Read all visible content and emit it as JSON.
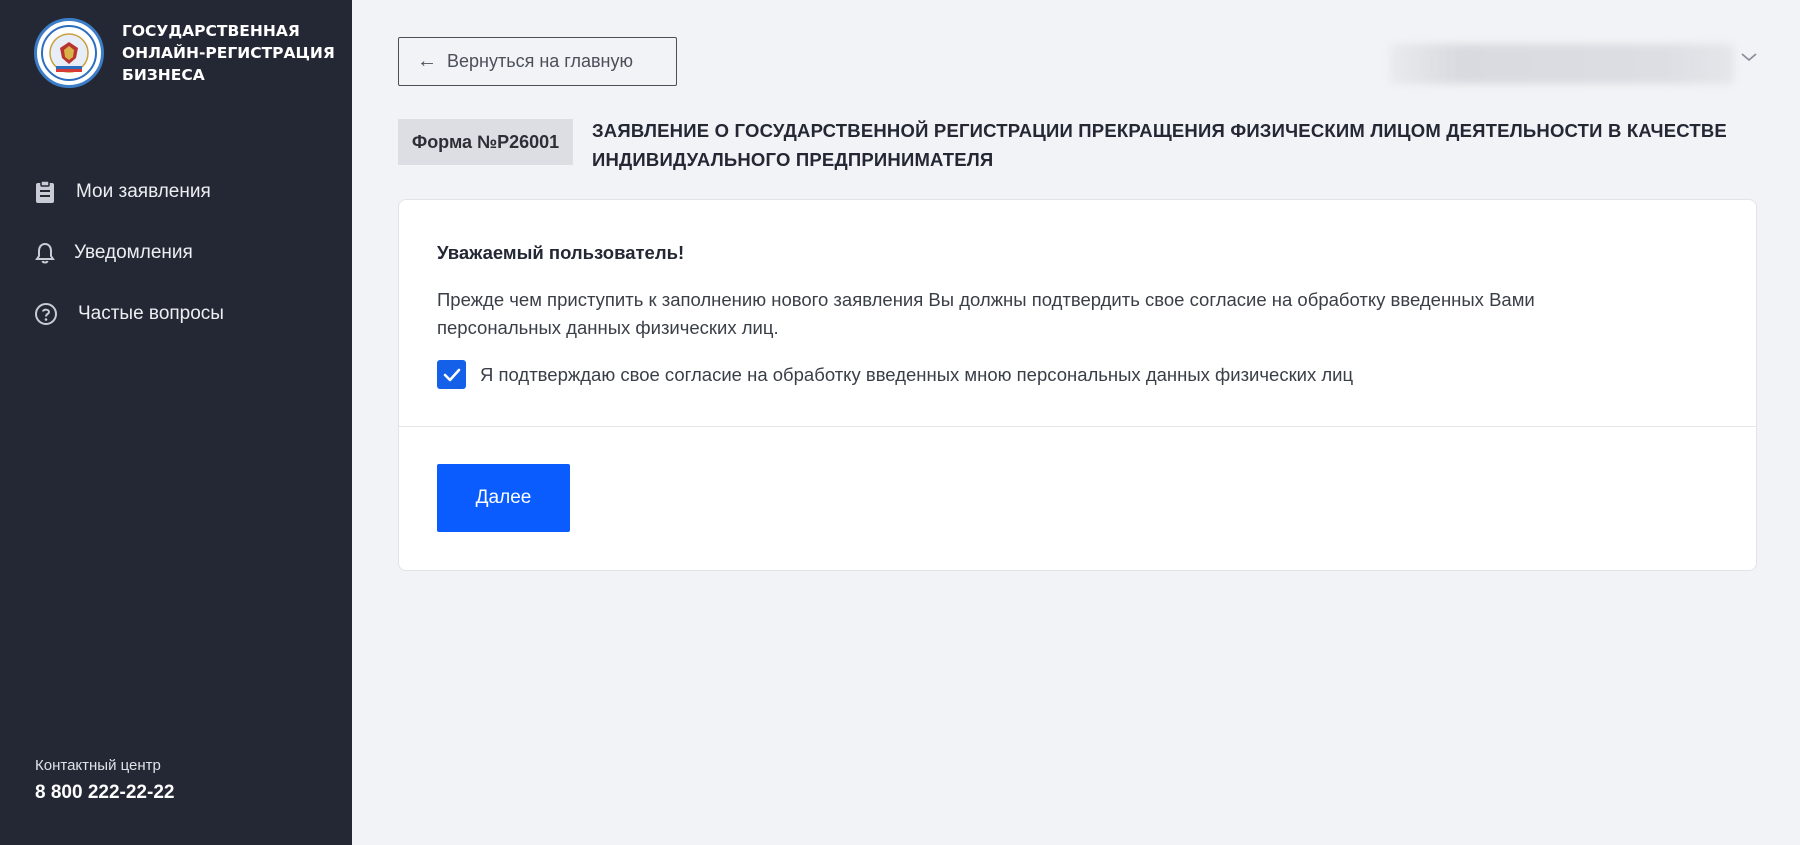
{
  "sidebar": {
    "brand_lines": [
      "ГОСУДАРСТВЕННАЯ",
      "ОНЛАЙН-РЕГИСТРАЦИЯ",
      "БИЗНЕСА"
    ],
    "items": [
      {
        "label": "Мои заявления",
        "icon": "clipboard-icon"
      },
      {
        "label": "Уведомления",
        "icon": "bell-icon"
      },
      {
        "label": "Частые вопросы",
        "icon": "question-circle-icon"
      }
    ],
    "contact_label": "Контактный центр",
    "contact_phone": "8 800 222-22-22"
  },
  "header": {
    "back_label": "Вернуться на главную"
  },
  "form": {
    "badge": "Форма №Р26001",
    "title": "ЗАЯВЛЕНИЕ О ГОСУДАРСТВЕННОЙ РЕГИСТРАЦИИ ПРЕКРАЩЕНИЯ ФИЗИЧЕСКИМ ЛИЦОМ ДЕЯТЕЛЬНОСТИ В КАЧЕСТВЕ ИНДИВИДУАЛЬНОГО ПРЕДПРИНИМАТЕЛЯ"
  },
  "card": {
    "greeting": "Уважаемый пользователь!",
    "intro": "Прежде чем приступить к заполнению нового заявления Вы должны подтвердить свое согласие на обработку введенных Вами персональных данных физических лиц.",
    "consent_label": "Я подтверждаю свое согласие на обработку введенных мною персональных данных физических лиц",
    "consent_checked": true,
    "next_label": "Далее"
  },
  "colors": {
    "sidebar_bg": "#242834",
    "page_bg": "#f2f3f6",
    "accent": "#0a5cff"
  }
}
